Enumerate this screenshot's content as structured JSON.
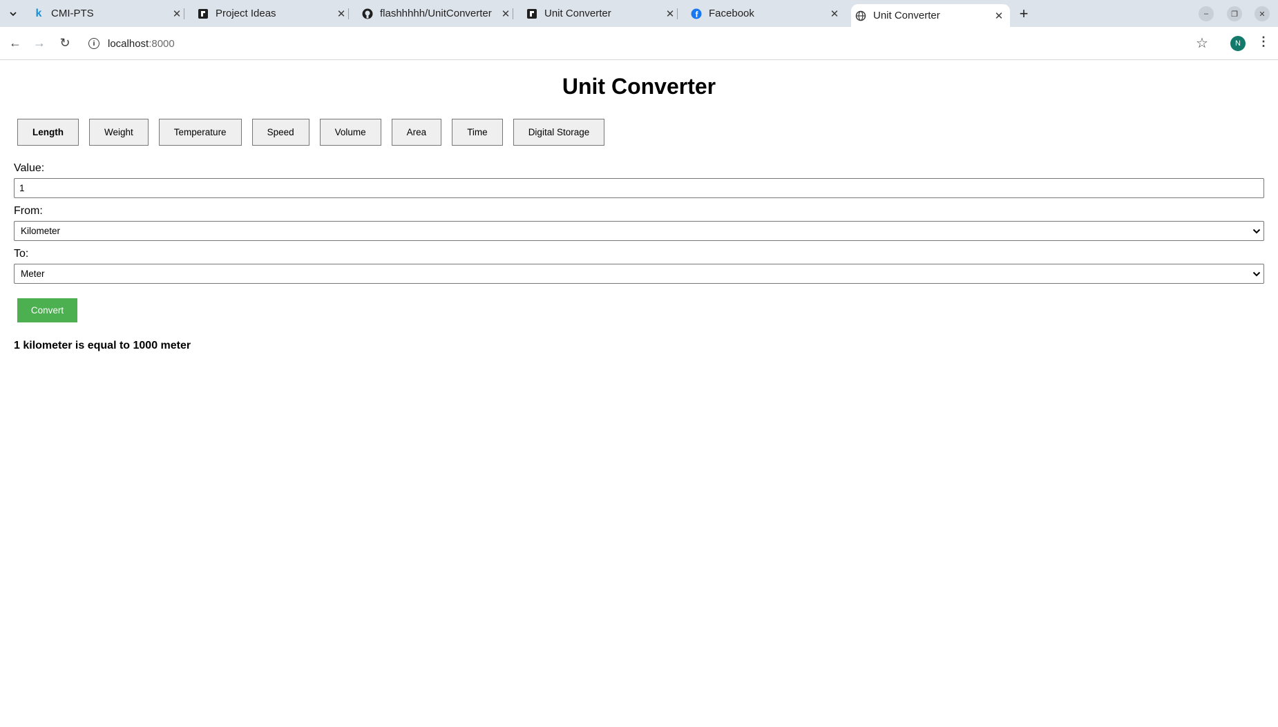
{
  "browser": {
    "tabs": [
      {
        "title": "CMI-PTS",
        "favicon": "k-logo-icon",
        "active": false
      },
      {
        "title": "Project Ideas",
        "favicon": "replit-icon",
        "active": false
      },
      {
        "title": "flashhhhh/UnitConverter",
        "favicon": "github-icon",
        "active": false
      },
      {
        "title": "Unit Converter",
        "favicon": "replit-icon",
        "active": false
      },
      {
        "title": "Facebook",
        "favicon": "facebook-icon",
        "active": false
      },
      {
        "title": "Unit Converter",
        "favicon": "globe-icon",
        "active": true
      }
    ],
    "address": {
      "host": "localhost",
      "port": ":8000"
    },
    "profile_initial": "N"
  },
  "page": {
    "title": "Unit Converter",
    "categories": [
      "Length",
      "Weight",
      "Temperature",
      "Speed",
      "Volume",
      "Area",
      "Time",
      "Digital Storage"
    ],
    "active_category": "Length",
    "value_label": "Value:",
    "value": "1",
    "from_label": "From:",
    "from_selected": "Kilometer",
    "to_label": "To:",
    "to_selected": "Meter",
    "convert_label": "Convert",
    "result": "1 kilometer is equal to 1000 meter"
  },
  "colors": {
    "tabstrip_bg": "#dde3ea",
    "convert_button": "#4caf50",
    "avatar": "#137a6b",
    "facebook_blue": "#1877f2"
  }
}
